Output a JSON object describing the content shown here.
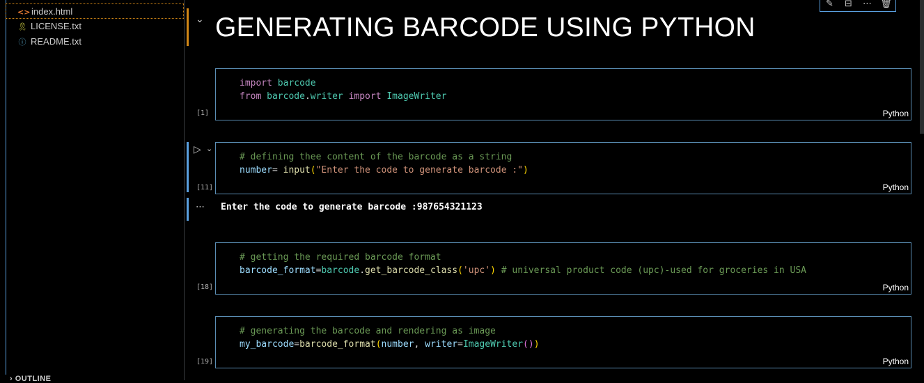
{
  "explorer": {
    "files": [
      {
        "name": "index.html",
        "icon": "html-file-icon",
        "selected": true
      },
      {
        "name": "LICENSE.txt",
        "icon": "license-file-icon"
      },
      {
        "name": "README.txt",
        "icon": "info-file-icon"
      }
    ],
    "outline_label": "OUTLINE"
  },
  "toolbar": [
    "edit-pencil-icon",
    "split-cell-icon",
    "more-icon",
    "delete-icon"
  ],
  "markdown": {
    "title": "GENERATING BARCODE USING PYTHON"
  },
  "cells": [
    {
      "exec": "[1]",
      "lang": "Python",
      "lines": [
        "import barcode",
        "from barcode.writer import ImageWriter"
      ]
    },
    {
      "exec": "[11]",
      "lang": "Python",
      "lines": [
        "# defining thee content of the barcode as a string",
        "number= input(\"Enter the code to generate barcode :\")"
      ]
    },
    {
      "exec": "[18]",
      "lang": "Python",
      "lines": [
        "# getting the required barcode format",
        "barcode_format=barcode.get_barcode_class('upc') # universal product code (upc)-used for groceries in USA"
      ]
    },
    {
      "exec": "[19]",
      "lang": "Python",
      "lines": [
        "# generating the barcode and rendering as image",
        "my_barcode=barcode_format(number, writer=ImageWriter())"
      ]
    }
  ],
  "output": {
    "text": "Enter the code to generate barcode :987654321123"
  }
}
